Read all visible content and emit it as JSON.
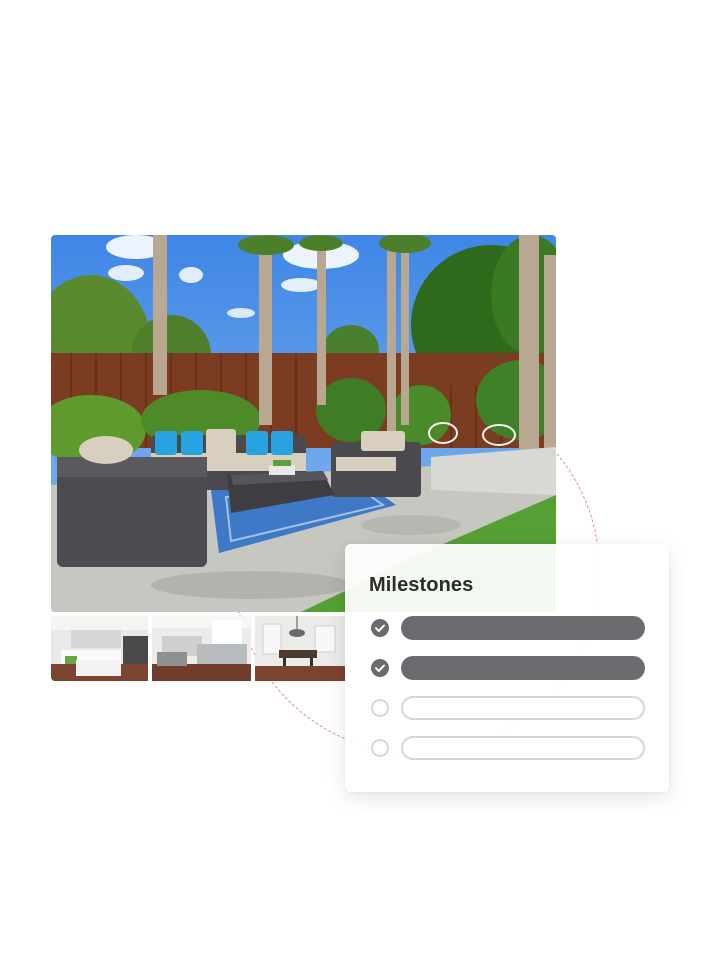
{
  "milestones_card": {
    "title": "Milestones",
    "items": [
      {
        "status": "completed",
        "icon": "check-icon"
      },
      {
        "status": "completed",
        "icon": "check-icon"
      },
      {
        "status": "pending",
        "icon": "empty-circle-icon"
      },
      {
        "status": "pending",
        "icon": "empty-circle-icon"
      }
    ]
  },
  "colors": {
    "completed": "#6b6a6e",
    "pending_border": "#d6d5d8",
    "orbit": "#e88b7a",
    "title": "#2b2b2b"
  }
}
